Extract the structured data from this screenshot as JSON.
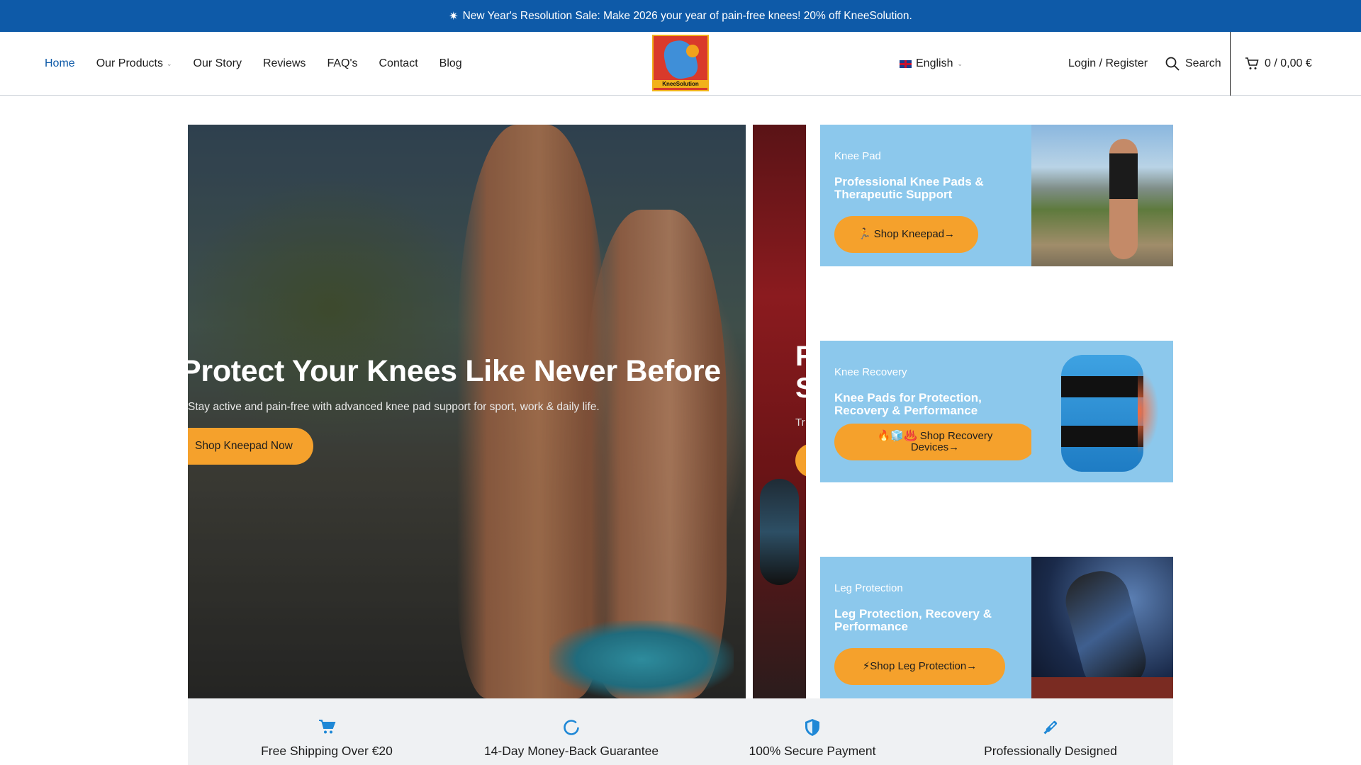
{
  "announcement": {
    "icon": "sparkle-icon",
    "text": "New Year's Resolution Sale: Make 2026 your year of pain-free knees! 20% off KneeSolution."
  },
  "nav": {
    "items": [
      {
        "label": "Home"
      },
      {
        "label": "Our Products"
      },
      {
        "label": "Our Story"
      },
      {
        "label": "Reviews"
      },
      {
        "label": "FAQ's"
      },
      {
        "label": "Contact"
      },
      {
        "label": "Blog"
      }
    ]
  },
  "logo": {
    "text": "KneeSolution"
  },
  "header": {
    "language": "English",
    "login": "Login / Register",
    "search": "Search",
    "cart": "0 / 0,00 €"
  },
  "hero": {
    "title": "Protect Your Knees Like Never Before",
    "subtitle": "Stay active and pain-free with advanced knee pad support for sport, work & daily life.",
    "cta": "Shop Kneepad Now"
  },
  "hero_next": {
    "title_line1": "R",
    "title_line2": "S",
    "subtitle": "Tr"
  },
  "cards": [
    {
      "category": "Knee Pad",
      "title": "Professional Knee Pads & Therapeutic Support",
      "button": "🏃 Shop Kneepad→"
    },
    {
      "category": "Knee Recovery",
      "title": "Knee Pads for Protection, Recovery & Performance",
      "button_line1": "🔥🧊♨️ Shop Recovery",
      "button_line2": "Devices→"
    },
    {
      "category": "Leg Protection",
      "title": "Leg Protection, Recovery & Performance",
      "button": "⚡Shop Leg Protection→"
    }
  ],
  "features": [
    {
      "icon": "cart-icon",
      "label": "Free Shipping Over €20"
    },
    {
      "icon": "refresh-icon",
      "label": "14-Day Money-Back Guarantee"
    },
    {
      "icon": "shield-icon",
      "label": "100% Secure Payment"
    },
    {
      "icon": "tool-icon",
      "label": "Professionally Designed"
    }
  ],
  "colors": {
    "brand_blue": "#0e5aa8",
    "cta_orange": "#f5a12c",
    "card_blue": "#8cc8ec",
    "feature_icon": "#1f88d6"
  }
}
